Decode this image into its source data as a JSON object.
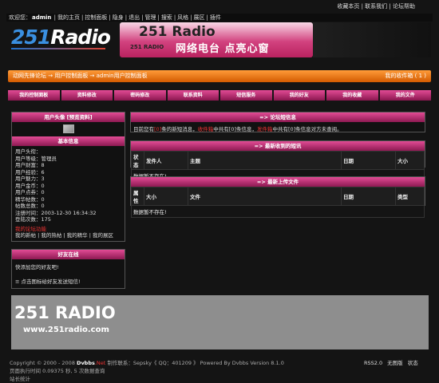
{
  "top_links": "收藏本页 | 联系我们 | 论坛帮助",
  "topnav": {
    "welcome": "欢迎您：",
    "user": "admin",
    "items": [
      "我的主页",
      "控制面板",
      "隐身",
      "退出",
      "管理",
      "搜索",
      "风格",
      "展区",
      "插件"
    ]
  },
  "logo": {
    "num": "251",
    "word": "Radio"
  },
  "banner": {
    "title": "251 Radio",
    "sub": "251 RADIO",
    "slogan": "网络电台  点亮心窗"
  },
  "breadcrumb": {
    "path": "动网先锋论坛 → 用户控制面板 → admin用户控制面板",
    "right": "我的收件箱 ( 1 )"
  },
  "menu": [
    "我的控制面板",
    "资料修改",
    "密码修改",
    "联系资料",
    "短信服务",
    "我的好友",
    "我的收藏",
    "我的文件"
  ],
  "avatar_panel": {
    "title": "用户头像 [预览资料]",
    "basic_title": "基本信息",
    "info": [
      "用户头衔：",
      "用户等级：管理员",
      "用户财富：8",
      "用户经验：6",
      "用户魅力：3",
      "用户金币：0",
      "用户点券：0",
      "精华帖数：0",
      "帖数总数：0",
      "注册时间：2003-12-30 16:34:32",
      "登陆次数：175"
    ],
    "forum_title": "我的论坛功能",
    "forum_links": "我的新帖 | 我的热帖 | 我的精华 | 我的展区"
  },
  "friends": {
    "title": "好友在线",
    "line1": "快添加您的好友吧!",
    "line2": "≡ 点击图标给好友发送短信!"
  },
  "msg_panel": {
    "title": "=> 论坛短信息",
    "t1": "目前您有",
    "n1": "[0]",
    "t2": "条的新短消息，",
    "l1": "收件箱",
    "t3": "中共有",
    "n2": "[0]",
    "t4": "条信息，",
    "l2": "发件箱",
    "t5": "中共有",
    "n3": "[0]",
    "t6": "条信息对方未查阅。"
  },
  "received": {
    "title": "=> 最新收到的短讯",
    "headers": [
      "状态",
      "发件人",
      "主题",
      "日期",
      "大小"
    ],
    "empty": "数据暂不存在!"
  },
  "uploads": {
    "title": "=> 最新上传文件",
    "headers": [
      "属性",
      "大小",
      "文件",
      "日期",
      "类型"
    ],
    "empty": "数据暂不存在!"
  },
  "footer_image": {
    "t1": "251 RADIO",
    "t2": "www.251radio.com"
  },
  "copyright": {
    "a": "Copyright © 2000 - 2008",
    "b": "Dvbbs",
    "c": ".Net",
    "d": "制作联系：Sepsky《 QQ：401209 》 Powered By",
    "e": "Dvbbs Version 8.1.0"
  },
  "exec_time": "页面执行时间 0.09375 秒, 5 次数据查询",
  "stats": "站长统计",
  "foot_links": "RSS2.0 无图版 状态"
}
